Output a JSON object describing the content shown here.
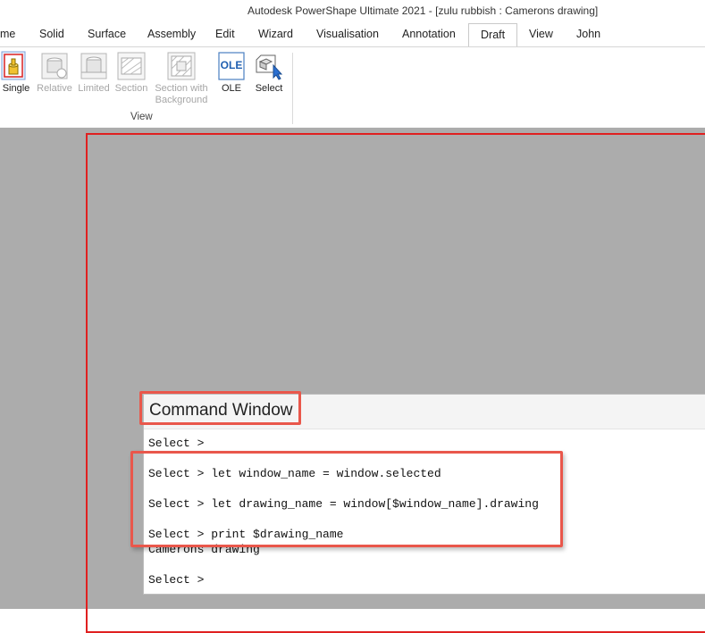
{
  "window": {
    "title": "Autodesk PowerShape Ultimate 2021 - [zulu rubbish : Camerons drawing]"
  },
  "tabs": [
    "me",
    "Solid",
    "Surface",
    "Assembly",
    "Edit",
    "Wizard",
    "Visualisation",
    "Annotation",
    "Draft",
    "View",
    "John"
  ],
  "active_tab": "Draft",
  "ribbon": {
    "group_label": "View",
    "buttons": [
      {
        "label": "Single",
        "enabled": true,
        "icon": "single-view-icon"
      },
      {
        "label": "Relative",
        "enabled": false,
        "icon": "relative-view-icon"
      },
      {
        "label": "Limited",
        "enabled": false,
        "icon": "limited-view-icon"
      },
      {
        "label": "Section",
        "enabled": false,
        "icon": "section-view-icon"
      },
      {
        "label": "Section with",
        "label2": "Background",
        "enabled": false,
        "icon": "section-background-icon"
      },
      {
        "label": "OLE",
        "enabled": true,
        "icon": "ole-icon",
        "icon_text": "OLE"
      },
      {
        "label": "Select",
        "enabled": true,
        "icon": "select-view-icon"
      }
    ]
  },
  "command_window": {
    "title": "Command Window",
    "lines": [
      "Select >",
      "Select > let window_name = window.selected",
      "Select > let drawing_name = window[$window_name].drawing",
      "Select > print $drawing_name",
      "Camerons drawing",
      "Select >"
    ]
  },
  "colors": {
    "highlight": "#e9574b",
    "frame": "#e02020",
    "canvas": "#acacac"
  }
}
